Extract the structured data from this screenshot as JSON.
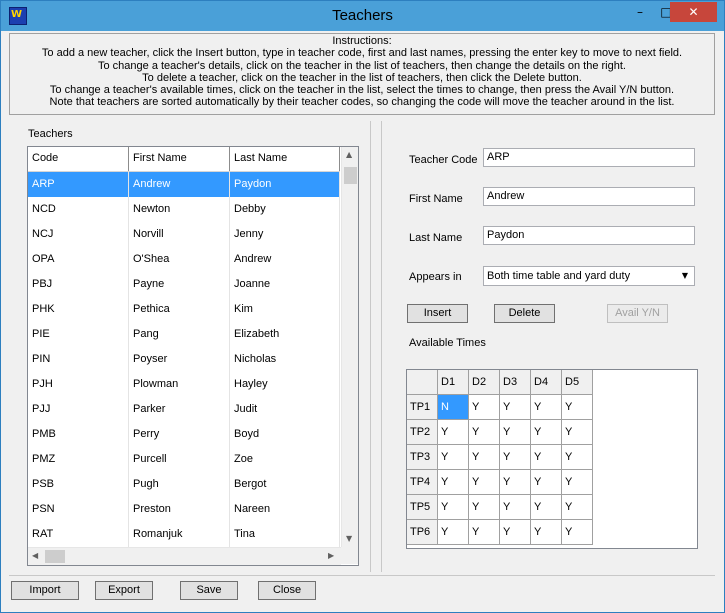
{
  "window": {
    "title": "Teachers"
  },
  "instructions": [
    "Instructions:",
    "To add a new teacher, click the Insert button, type in teacher code, first and last names, pressing the enter key to move to next field.",
    "To change a teacher's details, click on the teacher in the list of teachers, then change the details on the right.",
    "To delete a teacher, click on the teacher in the list of teachers, then click the Delete button.",
    "To change a teacher's available times, click on the teacher in the list, select the times to change, then press the Avail Y/N button.",
    "Note that teachers are sorted automatically by their teacher codes, so changing the code will move the teacher around in the list."
  ],
  "teachers_list": {
    "label": "Teachers",
    "columns": [
      "Code",
      "First Name",
      "Last Name"
    ],
    "selected_index": 0,
    "rows": [
      [
        "ARP",
        "Andrew",
        "Paydon"
      ],
      [
        "NCD",
        "Newton",
        "Debby"
      ],
      [
        "NCJ",
        "Norvill",
        "Jenny"
      ],
      [
        "OPA",
        "O'Shea",
        "Andrew"
      ],
      [
        "PBJ",
        "Payne",
        "Joanne"
      ],
      [
        "PHK",
        "Pethica",
        "Kim"
      ],
      [
        "PIE",
        "Pang",
        "Elizabeth"
      ],
      [
        "PIN",
        "Poyser",
        "Nicholas"
      ],
      [
        "PJH",
        "Plowman",
        "Hayley"
      ],
      [
        "PJJ",
        "Parker",
        "Judit"
      ],
      [
        "PMB",
        "Perry",
        "Boyd"
      ],
      [
        "PMZ",
        "Purcell",
        "Zoe"
      ],
      [
        "PSB",
        "Pugh",
        "Bergot"
      ],
      [
        "PSN",
        "Preston",
        "Nareen"
      ],
      [
        "RAT",
        "Romanjuk",
        "Tina"
      ]
    ]
  },
  "details": {
    "teacher_code_label": "Teacher Code",
    "teacher_code_value": "ARP",
    "first_name_label": "First Name",
    "first_name_value": "Andrew",
    "last_name_label": "Last Name",
    "last_name_value": "Paydon",
    "appears_in_label": "Appears in",
    "appears_in_value": "Both time table and yard duty"
  },
  "actions": {
    "insert": "Insert",
    "delete": "Delete",
    "avail": "Avail Y/N"
  },
  "available_times": {
    "label": "Available Times",
    "days": [
      "D1",
      "D2",
      "D3",
      "D4",
      "D5"
    ],
    "periods": [
      "TP1",
      "TP2",
      "TP3",
      "TP4",
      "TP5",
      "TP6"
    ],
    "selected_cell": [
      0,
      0
    ],
    "values": [
      [
        "N",
        "Y",
        "Y",
        "Y",
        "Y"
      ],
      [
        "Y",
        "Y",
        "Y",
        "Y",
        "Y"
      ],
      [
        "Y",
        "Y",
        "Y",
        "Y",
        "Y"
      ],
      [
        "Y",
        "Y",
        "Y",
        "Y",
        "Y"
      ],
      [
        "Y",
        "Y",
        "Y",
        "Y",
        "Y"
      ],
      [
        "Y",
        "Y",
        "Y",
        "Y",
        "Y"
      ]
    ]
  },
  "footer": {
    "import": "Import",
    "export": "Export",
    "save": "Save",
    "close": "Close"
  },
  "colors": {
    "selection": "#3399ff",
    "titlebar": "#4aa0d8",
    "close_button": "#c7463b"
  }
}
